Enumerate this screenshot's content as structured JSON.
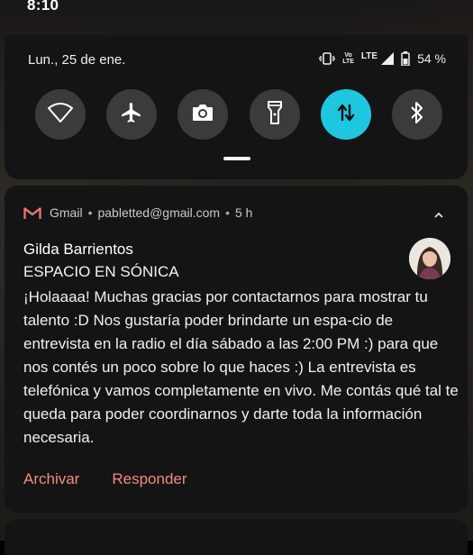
{
  "status_bar": {
    "time": "8:10"
  },
  "quick_settings": {
    "date": "Lun., 25 de ene.",
    "network_label": "LTE",
    "volte_top": "Vo",
    "volte_bottom": "LTE",
    "battery": "54 %",
    "tiles": [
      {
        "icon": "wifi-icon",
        "active": false
      },
      {
        "icon": "airplane-icon",
        "active": false
      },
      {
        "icon": "camera-icon",
        "active": false
      },
      {
        "icon": "flashlight-icon",
        "active": false
      },
      {
        "icon": "data-transfer-icon",
        "active": true
      },
      {
        "icon": "bluetooth-icon",
        "active": false
      }
    ],
    "accent_color": "#1fc6e0"
  },
  "notification": {
    "app": "Gmail",
    "account": "pabletted@gmail.com",
    "time": "5 h",
    "sender": "Gilda Barrientos",
    "subject": "ESPACIO EN SÓNICA",
    "body": "¡Holaaaa! Muchas gracias por contactarnos para mostrar tu talento :D Nos gustaría poder brindarte un espa-cio de entrevista en la radio el día sábado a las 2:00 PM :) para que nos contés un poco sobre lo que haces :) La entrevista es telefónica y vamos completamente en vivo. Me contás qué tal te queda para poder coordinarnos y darte toda la información necesaria.",
    "actions": {
      "archive": "Archivar",
      "reply": "Responder"
    },
    "action_color": "#f28b82"
  }
}
